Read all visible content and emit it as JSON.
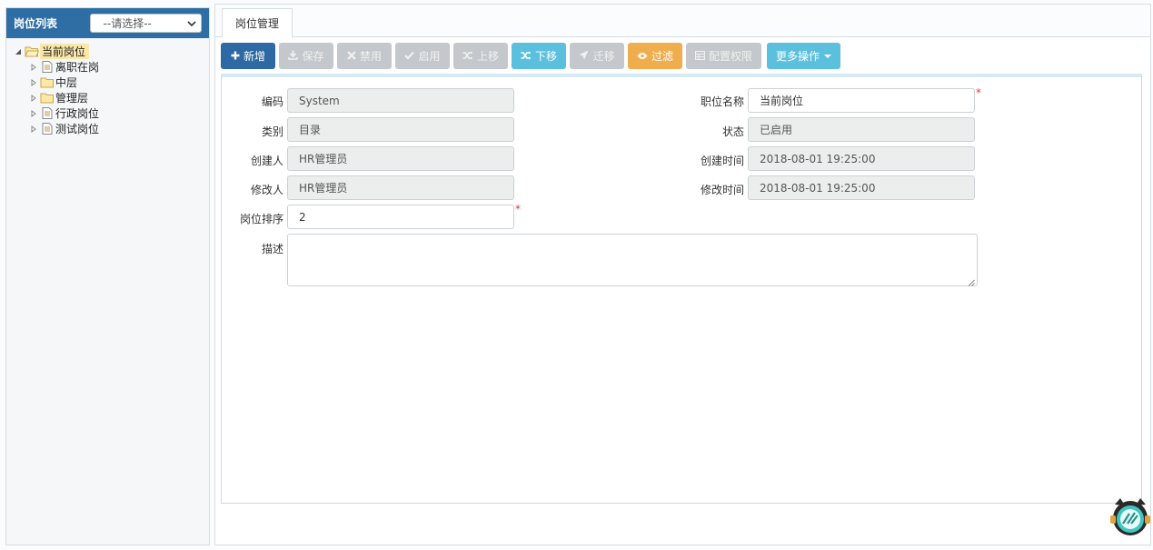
{
  "left": {
    "title": "岗位列表",
    "select_value": "--请选择--",
    "tree": [
      {
        "label": "当前岗位",
        "icon": "folder-open-icon",
        "level": 0,
        "toggle": "expanded",
        "selected": true
      },
      {
        "label": "离职在岗",
        "icon": "document-icon",
        "level": 1,
        "toggle": "collapsed"
      },
      {
        "label": "中层",
        "icon": "folder-icon",
        "level": 1,
        "toggle": "collapsed"
      },
      {
        "label": "管理层",
        "icon": "folder-icon",
        "level": 1,
        "toggle": "collapsed"
      },
      {
        "label": "行政岗位",
        "icon": "document-icon",
        "level": 1,
        "toggle": "collapsed"
      },
      {
        "label": "测试岗位",
        "icon": "document-icon",
        "level": 1,
        "toggle": "collapsed"
      }
    ]
  },
  "tab": {
    "label": "岗位管理"
  },
  "toolbar": {
    "new": "新增",
    "save": "保存",
    "disable": "禁用",
    "enable": "启用",
    "up": "上移",
    "down": "下移",
    "migrate": "迁移",
    "filter": "过滤",
    "permissions": "配置权限",
    "more": "更多操作"
  },
  "form": {
    "code_label": "编码",
    "code_value": "System",
    "name_label": "职位名称",
    "name_value": "当前岗位",
    "category_label": "类别",
    "category_value": "目录",
    "status_label": "状态",
    "status_value": "已启用",
    "creator_label": "创建人",
    "creator_value": "HR管理员",
    "created_label": "创建时间",
    "created_value": "2018-08-01 19:25:00",
    "modifier_label": "修改人",
    "modifier_value": "HR管理员",
    "modified_label": "修改时间",
    "modified_value": "2018-08-01 19:25:00",
    "order_label": "岗位排序",
    "order_value": "2",
    "desc_label": "描述",
    "desc_value": "",
    "required_mark": "*"
  },
  "colors": {
    "header_blue": "#2f6ea4",
    "primary": "#2d6aa3",
    "info": "#5bc0de",
    "warning": "#f0ad4e",
    "disabled": "#c4c8cc",
    "required": "#e23b3b"
  }
}
